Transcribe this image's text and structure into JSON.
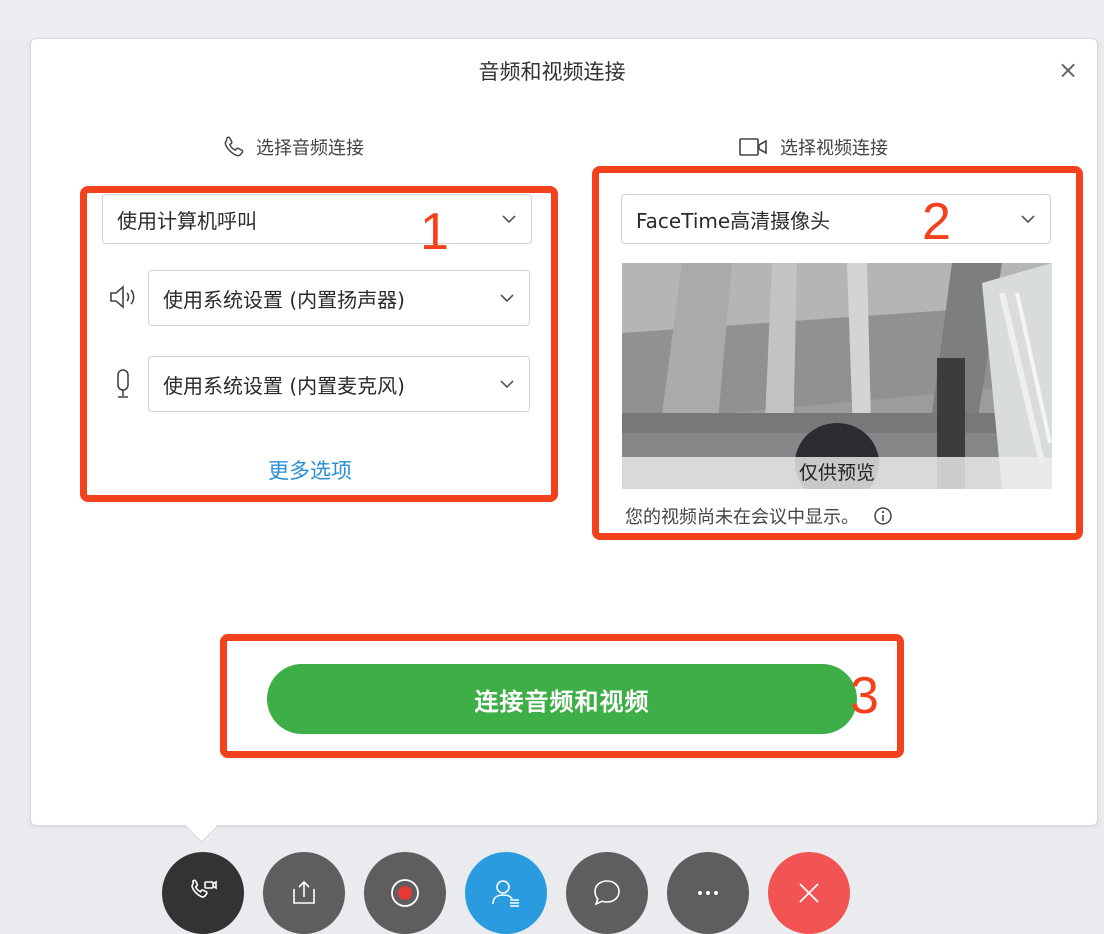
{
  "dialog": {
    "title": "音频和视频连接",
    "close_symbol": "×"
  },
  "audio": {
    "heading": "选择音频连接",
    "connection_select": "使用计算机呼叫",
    "speaker_select": "使用系统设置 (内置扬声器)",
    "mic_select": "使用系统设置 (内置麦克风)",
    "more_options": "更多选项"
  },
  "video": {
    "heading": "选择视频连接",
    "camera_select": "FaceTime高清摄像头",
    "preview_label": "仅供预览",
    "note": "您的视频尚未在会议中显示。"
  },
  "connect_button": "连接音频和视频",
  "annotations": [
    "1",
    "2",
    "3"
  ],
  "colors": {
    "accent_green": "#3eae47",
    "annotation_red": "#f3411c",
    "link_blue": "#2a8fd4",
    "participants_blue": "#2b9be0",
    "end_red": "#f15452",
    "dock_dark": "#333333",
    "dock_gray": "#5e5e5e"
  },
  "dock_icons": [
    "audio-video-icon",
    "share-icon",
    "record-icon",
    "participants-icon",
    "chat-icon",
    "more-icon",
    "end-icon"
  ]
}
